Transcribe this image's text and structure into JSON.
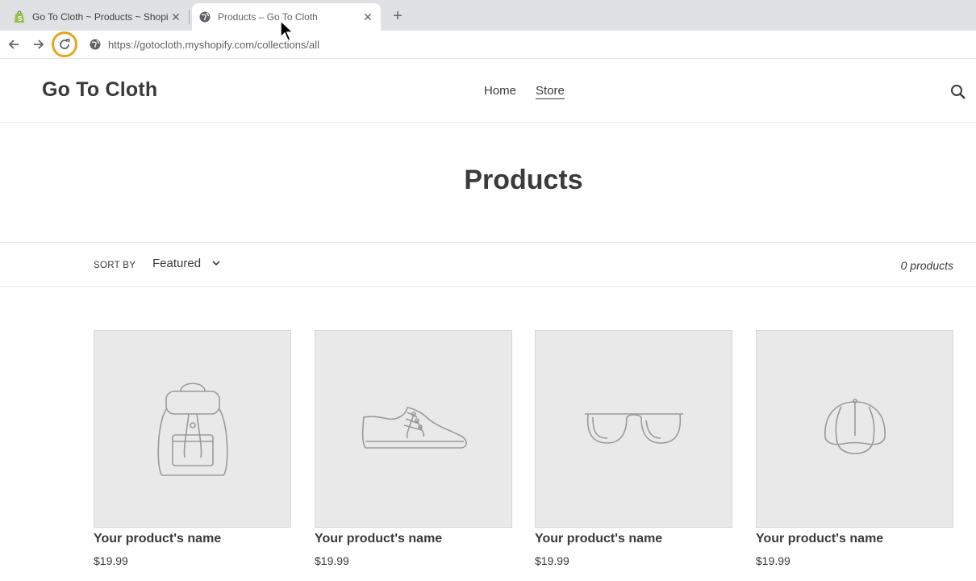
{
  "browser": {
    "tabs": [
      {
        "title": "Go To Cloth ~ Products ~ Shopif",
        "favicon": "shopify-icon",
        "active": false
      },
      {
        "title": "Products – Go To Cloth",
        "favicon": "globe-icon",
        "active": true
      }
    ],
    "new_tab": "+",
    "close_glyph": "✕",
    "url": "https://gotocloth.myshopify.com/collections/all"
  },
  "site": {
    "logo": "Go To Cloth",
    "nav": [
      {
        "label": "Home",
        "current": false
      },
      {
        "label": "Store",
        "current": true
      }
    ]
  },
  "page": {
    "title": "Products",
    "sort_label": "SORT BY",
    "sort_value": "Featured",
    "product_count": "0 products"
  },
  "products": [
    {
      "name": "Your product's name",
      "price": "$19.99",
      "icon": "backpack-icon"
    },
    {
      "name": "Your product's name",
      "price": "$19.99",
      "icon": "sneaker-icon"
    },
    {
      "name": "Your product's name",
      "price": "$19.99",
      "icon": "sunglasses-icon"
    },
    {
      "name": "Your product's name",
      "price": "$19.99",
      "icon": "cap-icon"
    }
  ],
  "colors": {
    "reload_highlight": "#e7a520",
    "text": "#3a3a3a",
    "placeholder_bg": "#e9e9e9"
  }
}
